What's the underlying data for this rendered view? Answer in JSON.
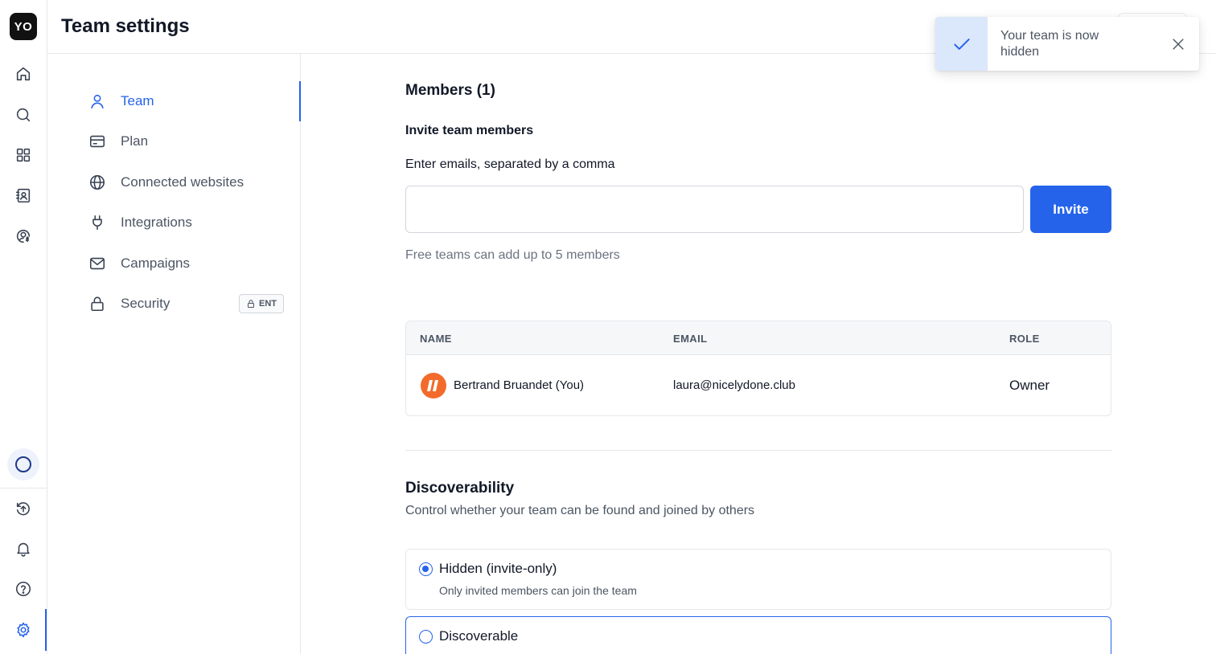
{
  "app": {
    "logo_text": "YO"
  },
  "rail": {
    "items": [
      {
        "name": "home-icon"
      },
      {
        "name": "search-icon"
      },
      {
        "name": "grid-icon"
      },
      {
        "name": "contacts-icon"
      },
      {
        "name": "billing-user-icon"
      },
      {
        "name": "status-ring-icon"
      },
      {
        "name": "upload-icon"
      },
      {
        "name": "bell-icon"
      },
      {
        "name": "help-icon"
      },
      {
        "name": "gear-icon",
        "active": true
      }
    ]
  },
  "header": {
    "title": "Team settings"
  },
  "settings_nav": {
    "items": [
      {
        "label": "Team",
        "icon": "user-icon",
        "active": true
      },
      {
        "label": "Plan",
        "icon": "credit-card-icon"
      },
      {
        "label": "Connected websites",
        "icon": "globe-icon"
      },
      {
        "label": "Integrations",
        "icon": "plug-icon"
      },
      {
        "label": "Campaigns",
        "icon": "mail-icon"
      },
      {
        "label": "Security",
        "icon": "lock-icon",
        "badge": "ENT"
      }
    ]
  },
  "members": {
    "title": "Members (1)",
    "invite_title": "Invite team members",
    "email_label": "Enter emails, separated by a comma",
    "email_value": "",
    "email_placeholder": "",
    "invite_button": "Invite",
    "hint": "Free teams can add up to 5 members",
    "table": {
      "columns": [
        "NAME",
        "EMAIL",
        "ROLE"
      ],
      "rows": [
        {
          "name": "Bertrand Bruandet (You)",
          "email": "laura@nicelydone.club",
          "role": "Owner"
        }
      ]
    }
  },
  "discoverability": {
    "title": "Discoverability",
    "subtitle": "Control whether your team can be found and joined by others",
    "options": [
      {
        "label": "Hidden (invite-only)",
        "description": "Only invited members can join the team",
        "selected": true
      },
      {
        "label": "Discoverable",
        "description": "",
        "selected": false
      }
    ]
  },
  "toast": {
    "message": "Your team is now hidden",
    "icon": "check-icon",
    "close_icon": "close-icon"
  },
  "colors": {
    "accent": "#2563eb",
    "avatar": "#f26b2a",
    "toast_icon_bg": "#dbe7fb"
  }
}
